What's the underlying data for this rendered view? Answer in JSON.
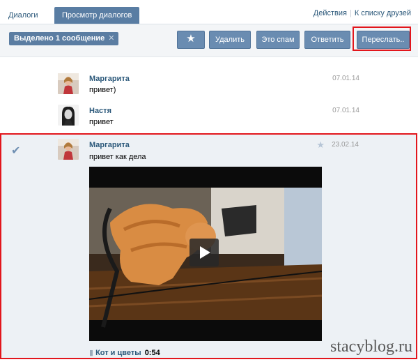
{
  "tabs": {
    "dialogs": "Диалоги",
    "view": "Просмотр диалогов"
  },
  "links": {
    "actions": "Действия",
    "separator": "|",
    "friends": "К списку друзей"
  },
  "toolbar": {
    "selected": "Выделено 1 сообщение",
    "clear_icon": "close-icon",
    "star_icon": "star-icon",
    "delete": "Удалить",
    "spam": "Это спам",
    "reply": "Ответить",
    "forward": "Переслать..",
    "accent_color": "#597da3",
    "highlight_color": "#e2161c"
  },
  "messages": [
    {
      "author": "Маргарита",
      "text": "привет)",
      "date": "07.01.14"
    },
    {
      "author": "Настя",
      "text": "привет",
      "date": "07.01.14"
    },
    {
      "author": "Маргарита",
      "text": "привет как дела",
      "date": "23.02.14",
      "selected": true,
      "video": {
        "title": "Кот и цветы",
        "duration": "0:54"
      }
    }
  ],
  "watermark": "stacyblog.ru"
}
